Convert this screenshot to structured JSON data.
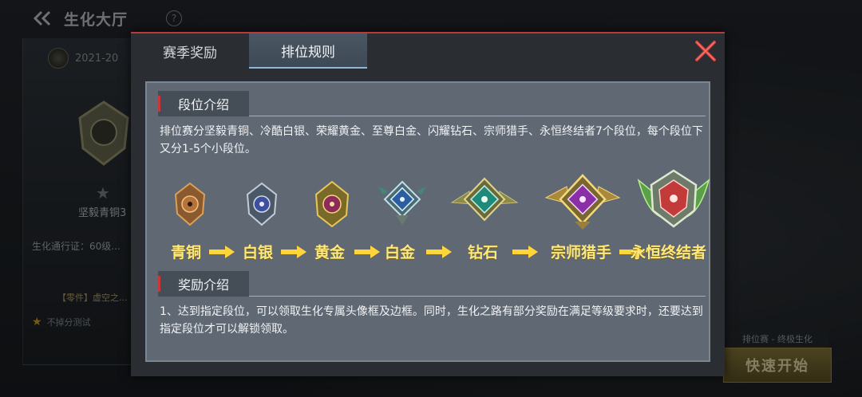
{
  "lobby": {
    "title": "生化大厅",
    "help": "?",
    "season": "2021-20",
    "rank_name": "坚毅青铜3",
    "pass_text": "生化通行证：60级...",
    "part_text": "【零件】虚空之...",
    "mode_text": "不掉分测试",
    "right_label": "排位赛 - 终极生化",
    "start_label": "快速开始"
  },
  "modal": {
    "tabs": [
      {
        "label": "赛季奖励",
        "active": false
      },
      {
        "label": "排位规则",
        "active": true
      }
    ],
    "accent": "#c93838"
  },
  "section1": {
    "title": "段位介绍",
    "text": "排位赛分坚毅青铜、冷酷白银、荣耀黄金、至尊白金、闪耀钻石、宗师猎手、永恒终结者7个段位，每个段位下又分1-5个小段位。"
  },
  "ranks": [
    {
      "label": "青铜",
      "color": "#b5733a",
      "icon": "biohazard-icon"
    },
    {
      "label": "白银",
      "color": "#3d4fa0",
      "icon": "biohazard-icon"
    },
    {
      "label": "黄金",
      "color": "#8e2a5a",
      "icon": "biohazard-icon"
    },
    {
      "label": "白金",
      "color": "#2a5ea0",
      "icon": "biohazard-icon"
    },
    {
      "label": "钻石",
      "color": "#1f8a7a",
      "icon": "biohazard-icon"
    },
    {
      "label": "宗师猎手",
      "color": "#8a2fa8",
      "icon": "biohazard-icon"
    },
    {
      "label": "永恒终结者",
      "color": "#c23a3a",
      "icon": "biohazard-icon"
    }
  ],
  "section2": {
    "title": "奖励介绍",
    "text": "1、达到指定段位，可以领取生化专属头像框及边框。同时，生化之路有部分奖励在满足等级要求时，还要达到指定段位才可以解锁领取。"
  }
}
